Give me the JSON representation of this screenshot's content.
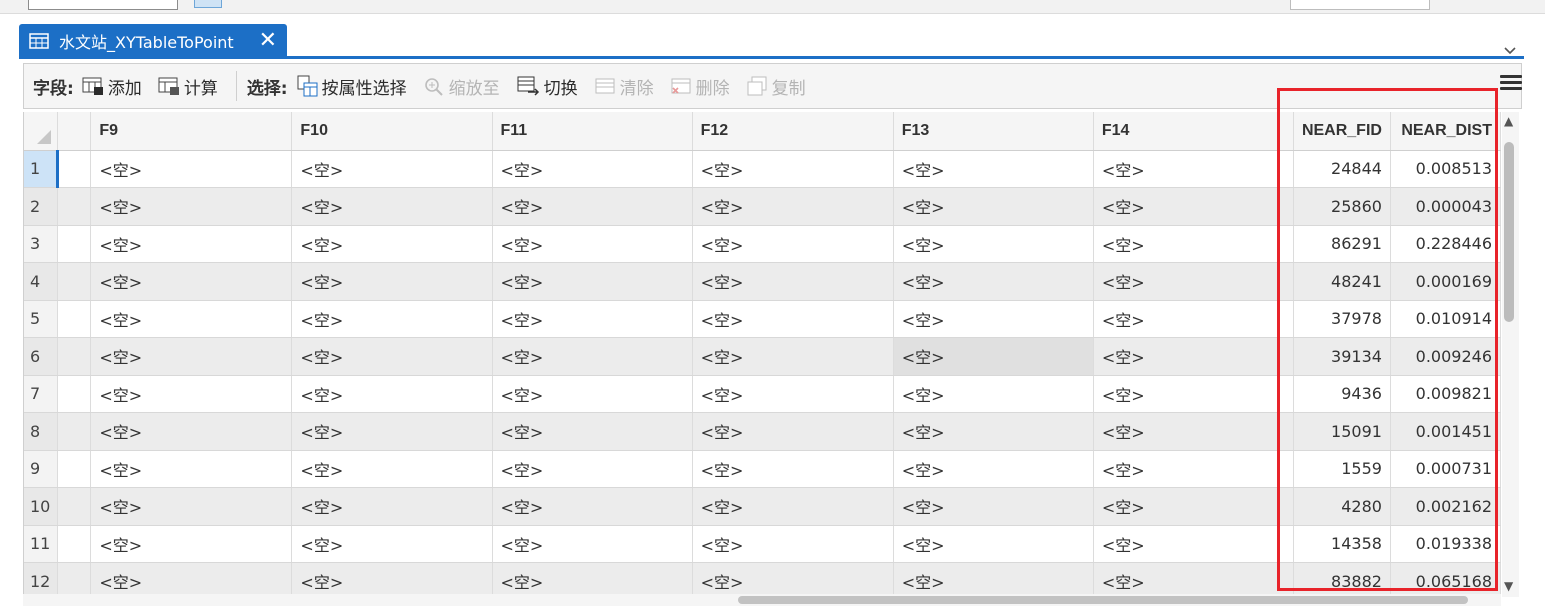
{
  "tab": {
    "title": "水文站_XYTableToPoint",
    "close": "✕"
  },
  "toolbar": {
    "field_label": "字段:",
    "add": "添加",
    "calculate": "计算",
    "select_label": "选择:",
    "select_by_attr": "按属性选择",
    "zoom_to": "缩放至",
    "switch": "切换",
    "clear": "清除",
    "delete": "删除",
    "copy": "复制"
  },
  "table": {
    "columns": [
      "F9",
      "F10",
      "F11",
      "F12",
      "F13",
      "F14",
      "NEAR_FID",
      "NEAR_DIST"
    ],
    "null_text": "<空>",
    "rows": [
      {
        "id": "1",
        "near_fid": "24844",
        "near_dist": "0.008513"
      },
      {
        "id": "2",
        "near_fid": "25860",
        "near_dist": "0.000043"
      },
      {
        "id": "3",
        "near_fid": "86291",
        "near_dist": "0.228446"
      },
      {
        "id": "4",
        "near_fid": "48241",
        "near_dist": "0.000169"
      },
      {
        "id": "5",
        "near_fid": "37978",
        "near_dist": "0.010914"
      },
      {
        "id": "6",
        "near_fid": "39134",
        "near_dist": "0.009246"
      },
      {
        "id": "7",
        "near_fid": "9436",
        "near_dist": "0.009821"
      },
      {
        "id": "8",
        "near_fid": "15091",
        "near_dist": "0.001451"
      },
      {
        "id": "9",
        "near_fid": "1559",
        "near_dist": "0.000731"
      },
      {
        "id": "10",
        "near_fid": "4280",
        "near_dist": "0.002162"
      },
      {
        "id": "11",
        "near_fid": "14358",
        "near_dist": "0.019338"
      },
      {
        "id": "12",
        "near_fid": "83882",
        "near_dist": "0.065168"
      }
    ]
  },
  "colors": {
    "accent": "#1c6fc6",
    "highlight_box": "#e8232a"
  }
}
